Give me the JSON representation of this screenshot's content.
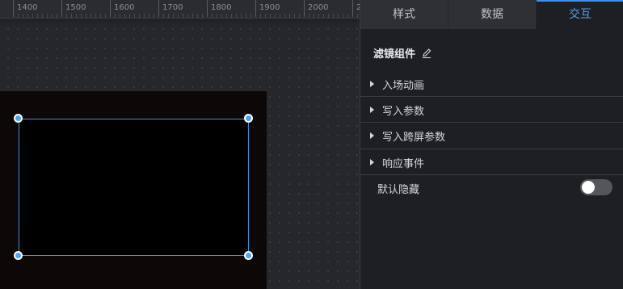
{
  "ruler": {
    "labels": [
      "1400",
      "1500",
      "1600",
      "1700",
      "1800",
      "1900",
      "2000",
      "2"
    ]
  },
  "panel": {
    "tabs": [
      {
        "label": "样式",
        "active": false
      },
      {
        "label": "数据",
        "active": false
      },
      {
        "label": "交互",
        "active": true
      }
    ],
    "component_title": "滤镜组件",
    "sections": [
      {
        "label": "入场动画"
      },
      {
        "label": "写入参数"
      },
      {
        "label": "写入跨屏参数"
      },
      {
        "label": "响应事件"
      }
    ],
    "default_hidden": {
      "label": "默认隐藏",
      "enabled": false
    }
  },
  "colors": {
    "accent": "#3d8ff0",
    "selection_border": "#3d8fd8",
    "handle_fill": "#4fa3f5",
    "panel_bg": "#1e1f22",
    "canvas_bg": "#26272b"
  },
  "icons": {
    "title_edit": "pencil-icon",
    "section_expand": "caret-right-icon"
  }
}
